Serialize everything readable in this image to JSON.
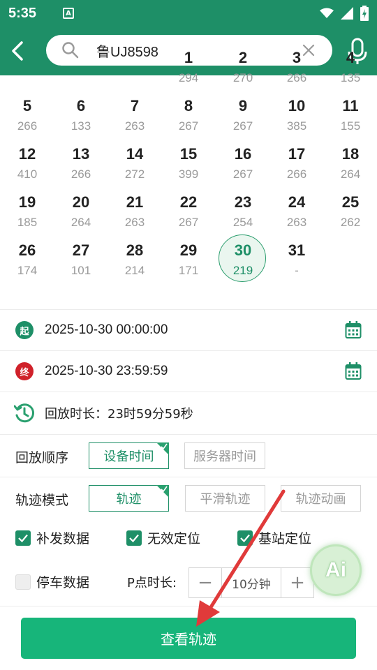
{
  "status_bar": {
    "time": "5:35",
    "notification_letter": "A"
  },
  "search": {
    "query": "鲁UJ8598"
  },
  "calendar": {
    "rows": [
      [
        {
          "day": "1",
          "count": "294"
        },
        {
          "day": "2",
          "count": "270"
        },
        {
          "day": "3",
          "count": "266"
        },
        {
          "day": "4",
          "count": "135"
        }
      ],
      [
        {
          "day": "5",
          "count": "266"
        },
        {
          "day": "6",
          "count": "133"
        },
        {
          "day": "7",
          "count": "263"
        },
        {
          "day": "8",
          "count": "267"
        },
        {
          "day": "9",
          "count": "267"
        },
        {
          "day": "10",
          "count": "385"
        },
        {
          "day": "11",
          "count": "155"
        }
      ],
      [
        {
          "day": "12",
          "count": "410"
        },
        {
          "day": "13",
          "count": "266"
        },
        {
          "day": "14",
          "count": "272"
        },
        {
          "day": "15",
          "count": "399"
        },
        {
          "day": "16",
          "count": "267"
        },
        {
          "day": "17",
          "count": "266"
        },
        {
          "day": "18",
          "count": "264"
        }
      ],
      [
        {
          "day": "19",
          "count": "185"
        },
        {
          "day": "20",
          "count": "264"
        },
        {
          "day": "21",
          "count": "263"
        },
        {
          "day": "22",
          "count": "267"
        },
        {
          "day": "23",
          "count": "254"
        },
        {
          "day": "24",
          "count": "263"
        },
        {
          "day": "25",
          "count": "262"
        }
      ],
      [
        {
          "day": "26",
          "count": "174"
        },
        {
          "day": "27",
          "count": "101"
        },
        {
          "day": "28",
          "count": "214"
        },
        {
          "day": "29",
          "count": "171"
        },
        {
          "day": "30",
          "count": "219",
          "selected": true
        },
        {
          "day": "31",
          "count": "-"
        }
      ]
    ]
  },
  "start": {
    "badge": "起",
    "value": "2025-10-30 00:00:00",
    "badge_color": "#1e8f67"
  },
  "end": {
    "badge": "终",
    "value": "2025-10-30 23:59:59",
    "badge_color": "#d0212a"
  },
  "duration": {
    "text": "回放时长：23时59分59秒"
  },
  "playback_order": {
    "label": "回放顺序",
    "options": [
      {
        "label": "设备时间",
        "active": true
      },
      {
        "label": "服务器时间",
        "active": false
      }
    ]
  },
  "track_mode": {
    "label": "轨迹模式",
    "options": [
      {
        "label": "轨迹",
        "active": true
      },
      {
        "label": "平滑轨迹",
        "active": false
      },
      {
        "label": "轨迹动画",
        "active": false
      }
    ]
  },
  "checkboxes": [
    {
      "label": "补发数据",
      "checked": true
    },
    {
      "label": "无效定位",
      "checked": true
    },
    {
      "label": "基站定位",
      "checked": true
    },
    {
      "label": "停车数据",
      "checked": false
    }
  ],
  "p_duration": {
    "label": "P点时长:",
    "value": "10分钟",
    "minus": "−",
    "plus": "+"
  },
  "ai_badge": {
    "text": "Ai"
  },
  "submit": {
    "label": "查看轨迹"
  },
  "colors": {
    "primary": "#1e8f67",
    "button": "#17b57a",
    "arrow": "#e03a3a"
  }
}
